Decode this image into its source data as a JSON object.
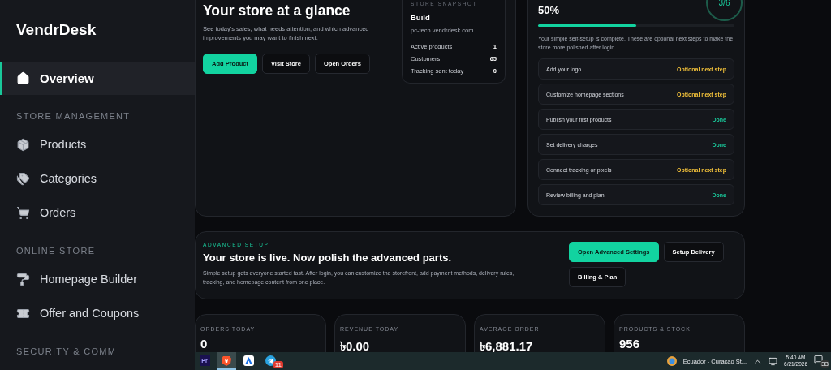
{
  "sidebar": {
    "brand": "VendrDesk",
    "sections": [
      {
        "items": [
          {
            "label": "Overview",
            "kind": "home",
            "selected": true
          }
        ]
      },
      {
        "heading": "STORE MANAGEMENT",
        "items": [
          {
            "label": "Products",
            "kind": "box",
            "selected": false
          },
          {
            "label": "Categories",
            "kind": "tags",
            "selected": false
          },
          {
            "label": "Orders",
            "kind": "cart",
            "selected": false
          }
        ]
      },
      {
        "heading": "ONLINE STORE",
        "items": [
          {
            "label": "Homepage Builder",
            "kind": "roller",
            "selected": false
          },
          {
            "label": "Offer and Coupons",
            "kind": "ticket",
            "selected": false
          }
        ]
      },
      {
        "heading": "SECURITY & COMM"
      }
    ]
  },
  "glance": {
    "title": "Your store at a glance",
    "description": "See today's sales, what needs attention, and which advanced improvements you may want to finish next.",
    "buttons": [
      {
        "label": "Add Product",
        "primary": true
      },
      {
        "label": "Visit Store",
        "primary": false
      },
      {
        "label": "Open Orders",
        "primary": false
      }
    ],
    "snapshot": {
      "label": "STORE SNAPSHOT",
      "name": "Build",
      "domain": "pc-tech.vendrdesk.com",
      "rows": [
        {
          "label": "Active products",
          "value": "1"
        },
        {
          "label": "Customers",
          "value": "65"
        },
        {
          "label": "Tracking sent today",
          "value": "0"
        }
      ]
    }
  },
  "setup": {
    "percent": "50%",
    "level": 0.5,
    "steps_count": "3/6",
    "description": "Your simple self-setup is complete. These are optional next steps to make the store more polished after login.",
    "steps": [
      {
        "label": "Add your logo",
        "status": "Optional next step",
        "kind": "optional"
      },
      {
        "label": "Customize homepage sections",
        "status": "Optional next step",
        "kind": "optional"
      },
      {
        "label": "Publish your first products",
        "status": "Done",
        "kind": "done"
      },
      {
        "label": "Set delivery charges",
        "status": "Done",
        "kind": "done"
      },
      {
        "label": "Connect tracking or pixels",
        "status": "Optional next step",
        "kind": "optional"
      },
      {
        "label": "Review billing and plan",
        "status": "Done",
        "kind": "done"
      }
    ]
  },
  "advanced": {
    "eyebrow": "ADVANCED SETUP",
    "title": "Your store is live. Now polish the advanced parts.",
    "description": "Simple setup gets everyone started fast. After login, you can customize the storefront, add payment methods, delivery rules, tracking, and homepage content from one place.",
    "buttons": [
      {
        "label": "Open Advanced Settings",
        "primary": true
      },
      {
        "label": "Setup Delivery",
        "primary": false
      },
      {
        "label": "Billing & Plan",
        "primary": false
      }
    ]
  },
  "stats": [
    {
      "label": "ORDERS TODAY",
      "value": "0"
    },
    {
      "label": "REVENUE TODAY",
      "value": "৳0.00"
    },
    {
      "label": "AVERAGE ORDER",
      "value": "৳6,881.17"
    },
    {
      "label": "PRODUCTS & STOCK",
      "value": "956"
    }
  ],
  "taskbar": {
    "apps": [
      {
        "kind": "premiere",
        "label": "Pr",
        "selected": false
      },
      {
        "kind": "browser",
        "selected": true
      },
      {
        "kind": "arrow",
        "selected": false
      },
      {
        "kind": "telegram",
        "badge": "11",
        "selected": false
      }
    ],
    "weather": "Ecuador - Curacao St...",
    "time": "5:40 AM",
    "date": "6/21/2026",
    "notifications": "33"
  }
}
